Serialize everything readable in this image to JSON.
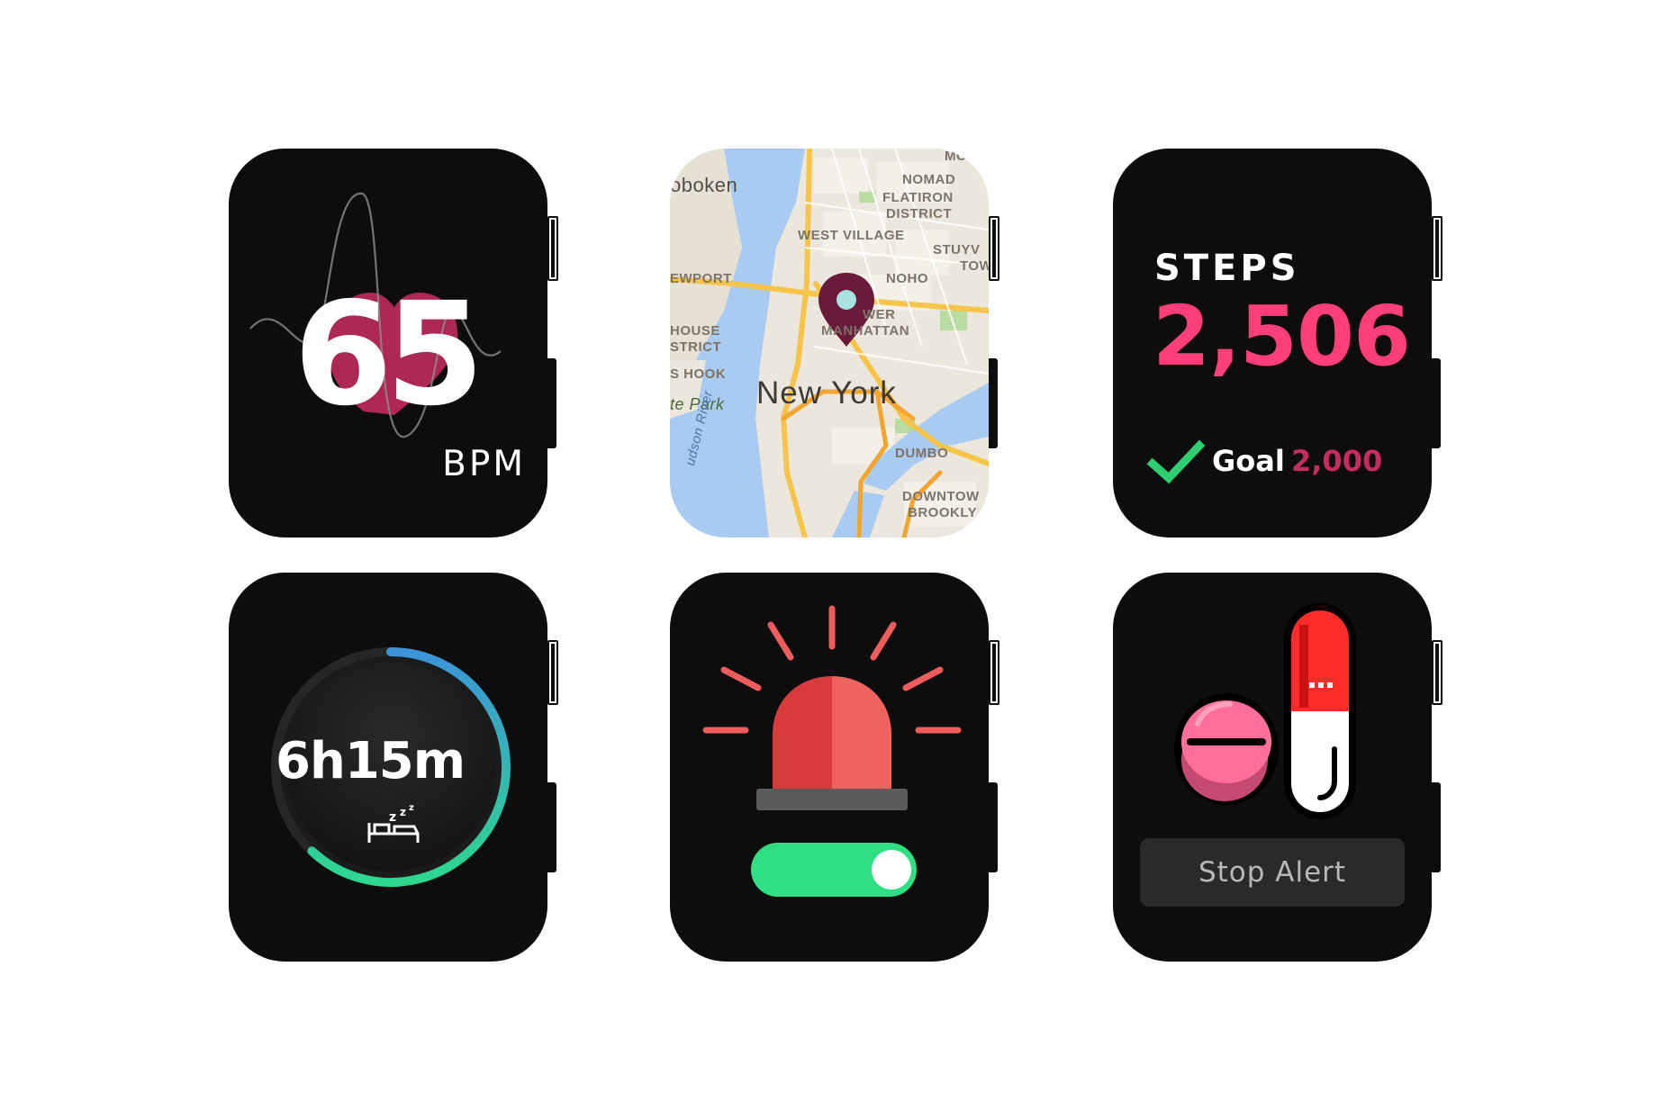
{
  "heart_rate": {
    "value": "65",
    "unit": "BPM"
  },
  "map": {
    "city": "New York",
    "labels": {
      "hoboken": "oboken",
      "nomad": "NOMAD",
      "flatiron": "FLATIRON",
      "district": "DISTRICT",
      "west_village": "WEST VILLAGE",
      "stuyv": "STUYV",
      "tow": "TOW",
      "newport": "EWPORT",
      "noho": "NOHO",
      "lower_manhattan_1": "WER",
      "lower_manhattan_2": "MANHATTAN",
      "house": "HOUSE",
      "strict": "STRICT",
      "paulus_hook": "S HOOK",
      "state_park": "te Park",
      "hudson_river": "udson River",
      "dumbo": "DUMBO",
      "downtown": "DOWNTOW",
      "brooklyn": "BROOKLY",
      "mc": "MC"
    }
  },
  "steps": {
    "title": "STEPS",
    "value": "2,506",
    "goal_label": "Goal",
    "goal_value": "2,000"
  },
  "sleep": {
    "value": "6h15m",
    "progress": 0.62
  },
  "alarm": {
    "toggle_on": true
  },
  "pills": {
    "button_label": "Stop Alert"
  },
  "colors": {
    "watch_face": "#0d0d0d",
    "steps_accent": "#ff3e7a",
    "goal_accent": "#c62c5f",
    "check_green": "#2ecf72",
    "toggle_green": "#2fe083",
    "heart": "#c42c5c",
    "siren_red": "#e9413f",
    "pill_red": "#ff2a2a",
    "tablet_pink": "#ff6f9a"
  }
}
